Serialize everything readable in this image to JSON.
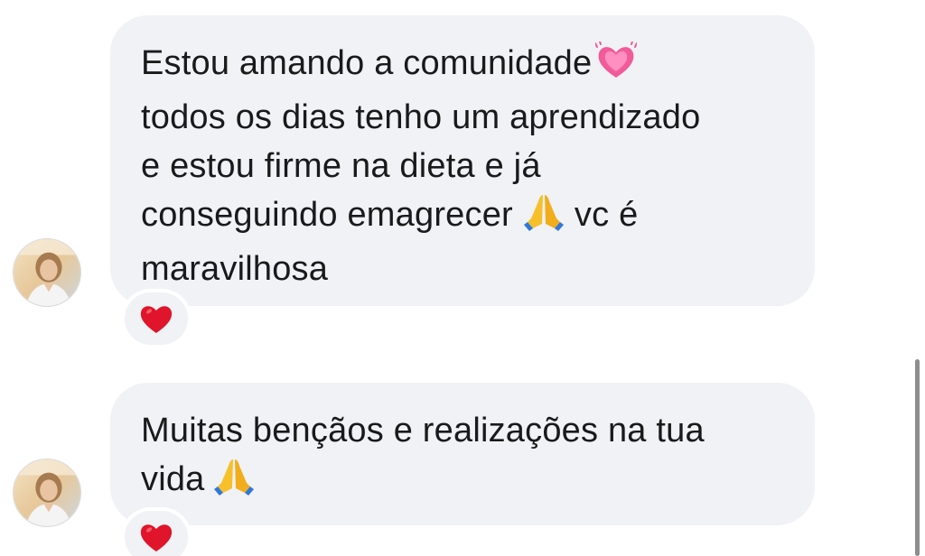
{
  "messages": [
    {
      "lines": [
        {
          "text": "Estou amando a comunidade",
          "emoji_after": "growing-heart-icon"
        },
        {
          "text": "todos os dias tenho um aprendizado"
        },
        {
          "text": "e estou firme na dieta e já"
        },
        {
          "text": "conseguindo emagrecer",
          "emoji_after": "folded-hands-icon",
          "text_after": "vc é"
        },
        {
          "text": "maravilhosa"
        }
      ],
      "reaction": "red-heart-icon"
    },
    {
      "lines": [
        {
          "text": "Muitas bençãos e realizações na tua"
        },
        {
          "text": "vida",
          "emoji_after": "folded-hands-icon"
        }
      ],
      "reaction": "red-heart-icon"
    }
  ],
  "colors": {
    "bubble_bg": "#f0f2f5",
    "text": "#1a1a1a",
    "heart_red": "#e0142a",
    "growing_heart_pink": "#f25b9a",
    "folded_hands_yellow": "#f7c02b"
  }
}
